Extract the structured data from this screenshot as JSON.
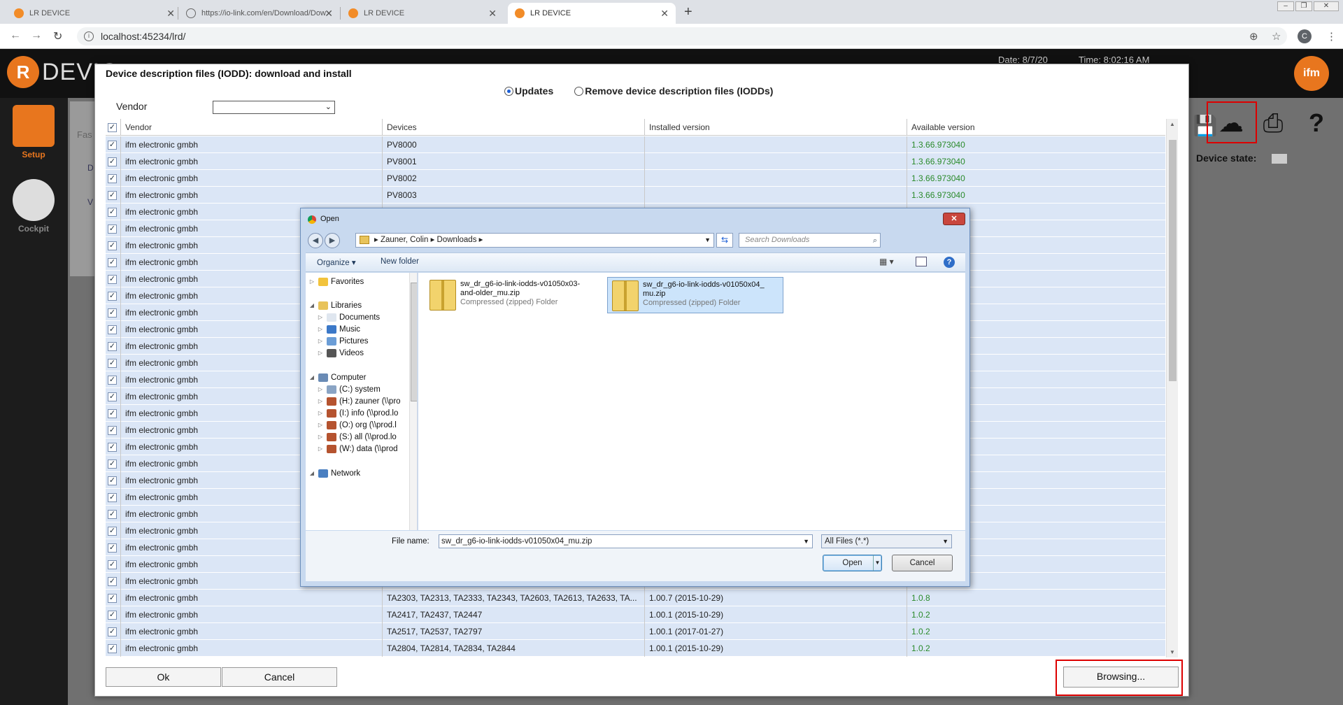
{
  "browser": {
    "tabs": [
      {
        "title": "LR DEVICE"
      },
      {
        "title": "https://io-link.com/en/Download/Dow"
      },
      {
        "title": "LR DEVICE"
      },
      {
        "title": "LR DEVICE"
      }
    ],
    "url": "localhost:45234/lrd/",
    "profile_initial": "C"
  },
  "app": {
    "name": "DEVIC",
    "logo_letter": "R",
    "brand": "ifm",
    "header_date": "Date: 8/7/20",
    "header_time": "Time: 8:02:16 AM",
    "nav": [
      {
        "label": "Setup"
      },
      {
        "label": "Cockpit"
      }
    ],
    "device_state_label": "Device state:",
    "bg_fragments": [
      "Fas",
      "D",
      "V"
    ],
    "accent_color": "#e8761e"
  },
  "modal": {
    "title": "Device description files (IODD): download and install",
    "radio_updates": "Updates",
    "radio_remove": "Remove device description files (IODDs)",
    "vendor_label": "Vendor",
    "vendor_value": "",
    "columns": [
      "Vendor",
      "Devices",
      "Installed version",
      "Available version"
    ],
    "rows_top": [
      {
        "vendor": "ifm electronic gmbh",
        "devices": "PV8000",
        "installed": "",
        "available": "1.3.66.973040"
      },
      {
        "vendor": "ifm electronic gmbh",
        "devices": "PV8001",
        "installed": "",
        "available": "1.3.66.973040"
      },
      {
        "vendor": "ifm electronic gmbh",
        "devices": "PV8002",
        "installed": "",
        "available": "1.3.66.973040"
      },
      {
        "vendor": "ifm electronic gmbh",
        "devices": "PV8003",
        "installed": "",
        "available": "1.3.66.973040"
      }
    ],
    "rows_hidden_vendor": "ifm electronic gmbh",
    "hidden_row_count": 23,
    "rows_bottom": [
      {
        "vendor": "ifm electronic gmbh",
        "devices": "TA2303, TA2313, TA2333, TA2343, TA2603, TA2613, TA2633, TA...",
        "installed": "1.00.7 (2015-10-29)",
        "available": "1.0.8"
      },
      {
        "vendor": "ifm electronic gmbh",
        "devices": "TA2417, TA2437, TA2447",
        "installed": "1.00.1 (2015-10-29)",
        "available": "1.0.2"
      },
      {
        "vendor": "ifm electronic gmbh",
        "devices": "TA2517, TA2537, TA2797",
        "installed": "1.00.1 (2017-01-27)",
        "available": "1.0.2"
      },
      {
        "vendor": "ifm electronic gmbh",
        "devices": "TA2804, TA2814, TA2834, TA2844",
        "installed": "1.00.1 (2015-10-29)",
        "available": "1.0.2"
      }
    ],
    "ok_label": "Ok",
    "cancel_label": "Cancel",
    "browse_label": "Browsing..."
  },
  "open_dialog": {
    "title": "Open",
    "path": [
      "Zauner, Colin",
      "Downloads"
    ],
    "search_placeholder": "Search Downloads",
    "organize_label": "Organize",
    "new_folder_label": "New folder",
    "nav_tree": [
      {
        "label": "Favorites",
        "level": 0
      },
      {
        "label": "Libraries",
        "level": 0
      },
      {
        "label": "Documents",
        "level": 1
      },
      {
        "label": "Music",
        "level": 1
      },
      {
        "label": "Pictures",
        "level": 1
      },
      {
        "label": "Videos",
        "level": 1
      },
      {
        "label": "Computer",
        "level": 0
      },
      {
        "label": "(C:) system",
        "level": 1
      },
      {
        "label": "(H:) zauner (\\\\pro",
        "level": 1
      },
      {
        "label": "(I:) info (\\\\prod.lo",
        "level": 1
      },
      {
        "label": "(O:) org (\\\\prod.l",
        "level": 1
      },
      {
        "label": "(S:) all (\\\\prod.lo",
        "level": 1
      },
      {
        "label": "(W:) data (\\\\prod",
        "level": 1
      },
      {
        "label": "Network",
        "level": 0
      }
    ],
    "files": [
      {
        "name_line1": "sw_dr_g6-io-link-iodds-v01050x03-",
        "name_line2": "and-older_mu.zip",
        "type": "Compressed (zipped) Folder",
        "selected": false
      },
      {
        "name_line1": "sw_dr_g6-io-link-iodds-v01050x04_",
        "name_line2": "mu.zip",
        "type": "Compressed (zipped) Folder",
        "selected": true
      }
    ],
    "file_name_label": "File name:",
    "file_name_value": "sw_dr_g6-io-link-iodds-v01050x04_mu.zip",
    "file_type_value": "All Files (*.*)",
    "open_label": "Open",
    "cancel_label": "Cancel"
  }
}
